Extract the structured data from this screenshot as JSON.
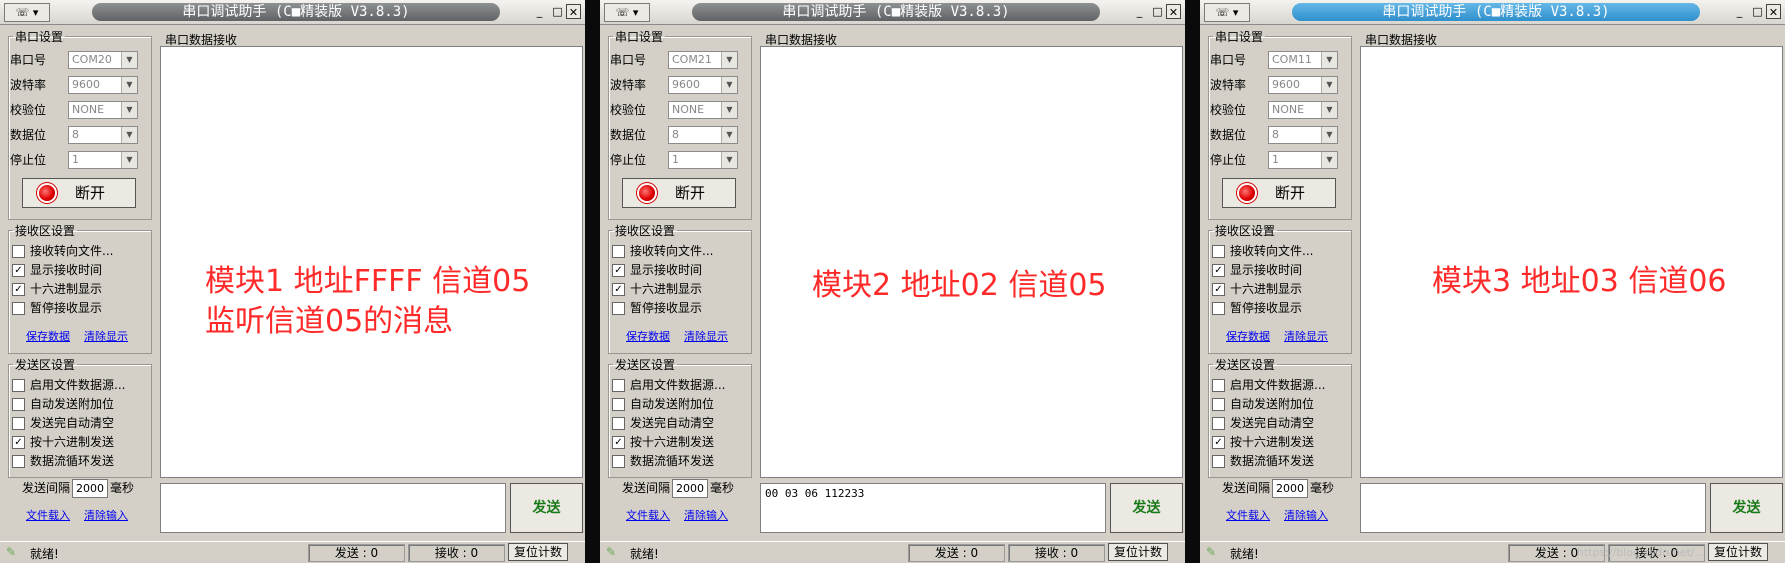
{
  "windows": [
    {
      "title": "串口调试助手 (C■精装版 V3.8.3)",
      "sysmenu": "☏ ▾",
      "serial_group": "串口设置",
      "port_label": "串口号",
      "port_value": "COM20",
      "baud_label": "波特率",
      "baud_value": "9600",
      "parity_label": "校验位",
      "parity_value": "NONE",
      "databits_label": "数据位",
      "databits_value": "8",
      "stopbits_label": "停止位",
      "stopbits_value": "1",
      "connect_label": "断开",
      "recv_group": "接收区设置",
      "recv_opts": [
        {
          "label": "接收转向文件...",
          "mark": ""
        },
        {
          "label": "显示接收时间",
          "mark": "✓"
        },
        {
          "label": "十六进制显示",
          "mark": "✓"
        },
        {
          "label": "暂停接收显示",
          "mark": ""
        }
      ],
      "save_data": "保存数据",
      "clear_display": "清除显示",
      "send_group": "发送区设置",
      "send_opts": [
        {
          "label": "启用文件数据源...",
          "mark": ""
        },
        {
          "label": "自动发送附加位",
          "mark": ""
        },
        {
          "label": "发送完自动清空",
          "mark": ""
        },
        {
          "label": "按十六进制发送",
          "mark": "✓"
        },
        {
          "label": "数据流循环发送",
          "mark": ""
        }
      ],
      "interval_label": "发送间隔",
      "interval_value": "2000",
      "interval_unit": "毫秒",
      "file_load": "文件载入",
      "clear_input": "清除输入",
      "recv_panel_title": "串口数据接收",
      "send_text": "",
      "send_button": "发送",
      "status_text": "就绪!",
      "sent_count": "发送 : 0",
      "recv_count": "接收 : 0",
      "reset_label": "复位计数",
      "annotation": [
        "模块1 地址FFFF 信道05",
        "监听信道05的消息"
      ]
    },
    {
      "title": "串口调试助手 (C■精装版 V3.8.3)",
      "sysmenu": "☏ ▾",
      "serial_group": "串口设置",
      "port_label": "串口号",
      "port_value": "COM21",
      "baud_label": "波特率",
      "baud_value": "9600",
      "parity_label": "校验位",
      "parity_value": "NONE",
      "databits_label": "数据位",
      "databits_value": "8",
      "stopbits_label": "停止位",
      "stopbits_value": "1",
      "connect_label": "断开",
      "recv_group": "接收区设置",
      "recv_opts": [
        {
          "label": "接收转向文件...",
          "mark": ""
        },
        {
          "label": "显示接收时间",
          "mark": "✓"
        },
        {
          "label": "十六进制显示",
          "mark": "✓"
        },
        {
          "label": "暂停接收显示",
          "mark": ""
        }
      ],
      "save_data": "保存数据",
      "clear_display": "清除显示",
      "send_group": "发送区设置",
      "send_opts": [
        {
          "label": "启用文件数据源...",
          "mark": ""
        },
        {
          "label": "自动发送附加位",
          "mark": ""
        },
        {
          "label": "发送完自动清空",
          "mark": ""
        },
        {
          "label": "按十六进制发送",
          "mark": "✓"
        },
        {
          "label": "数据流循环发送",
          "mark": ""
        }
      ],
      "interval_label": "发送间隔",
      "interval_value": "2000",
      "interval_unit": "毫秒",
      "file_load": "文件载入",
      "clear_input": "清除输入",
      "recv_panel_title": "串口数据接收",
      "send_text": "00 03 06 112233",
      "send_button": "发送",
      "status_text": "就绪!",
      "sent_count": "发送 : 0",
      "recv_count": "接收 : 0",
      "reset_label": "复位计数",
      "annotation": [
        "模块2 地址02 信道05"
      ]
    },
    {
      "title": "串口调试助手 (C■精装版 V3.8.3)",
      "sysmenu": "☏ ▾",
      "serial_group": "串口设置",
      "port_label": "串口号",
      "port_value": "COM11",
      "baud_label": "波特率",
      "baud_value": "9600",
      "parity_label": "校验位",
      "parity_value": "NONE",
      "databits_label": "数据位",
      "databits_value": "8",
      "stopbits_label": "停止位",
      "stopbits_value": "1",
      "connect_label": "断开",
      "recv_group": "接收区设置",
      "recv_opts": [
        {
          "label": "接收转向文件...",
          "mark": ""
        },
        {
          "label": "显示接收时间",
          "mark": "✓"
        },
        {
          "label": "十六进制显示",
          "mark": "✓"
        },
        {
          "label": "暂停接收显示",
          "mark": ""
        }
      ],
      "save_data": "保存数据",
      "clear_display": "清除显示",
      "send_group": "发送区设置",
      "send_opts": [
        {
          "label": "启用文件数据源...",
          "mark": ""
        },
        {
          "label": "自动发送附加位",
          "mark": ""
        },
        {
          "label": "发送完自动清空",
          "mark": ""
        },
        {
          "label": "按十六进制发送",
          "mark": "✓"
        },
        {
          "label": "数据流循环发送",
          "mark": ""
        }
      ],
      "interval_label": "发送间隔",
      "interval_value": "2000",
      "interval_unit": "毫秒",
      "file_load": "文件载入",
      "clear_input": "清除输入",
      "recv_panel_title": "串口数据接收",
      "send_text": "",
      "send_button": "发送",
      "status_text": "就绪!",
      "sent_count": "发送 : 0",
      "recv_count": "接收 : 0",
      "reset_label": "复位计数",
      "annotation": [
        "模块3 地址03 信道06"
      ]
    }
  ],
  "watermark": "https://blog.csdn.net/..."
}
